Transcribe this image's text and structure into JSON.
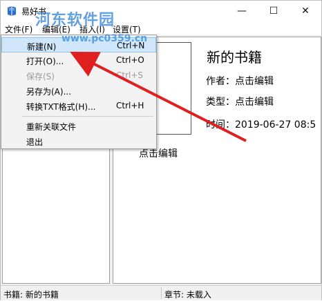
{
  "window": {
    "title": "易好书",
    "minimize_glyph": "—",
    "maximize_glyph": "☐",
    "close_glyph": "✕"
  },
  "watermark": {
    "text": "河东软件园",
    "url": "www.pc0359.cn"
  },
  "menubar": {
    "items": [
      {
        "label": "文件(F)"
      },
      {
        "label": "编辑(E)"
      },
      {
        "label": "插入(I)"
      },
      {
        "label": "设置(T)"
      }
    ]
  },
  "file_menu": {
    "items": [
      {
        "label": "新建(N)",
        "shortcut": "Ctrl+N",
        "highlighted": true,
        "enabled": true
      },
      {
        "label": "打开(O)...",
        "shortcut": "Ctrl+O",
        "enabled": true
      },
      {
        "label": "保存(S)",
        "shortcut": "Ctrl+S",
        "enabled": false
      },
      {
        "label": "另存为(A)...",
        "shortcut": "",
        "enabled": true
      },
      {
        "label": "转换TXT格式(H)...",
        "shortcut": "Ctrl+H",
        "enabled": true
      },
      {
        "label": "重新关联文件",
        "shortcut": "",
        "enabled": true
      },
      {
        "label": "退出",
        "shortcut": "",
        "enabled": true
      }
    ]
  },
  "book": {
    "title": "新的书籍",
    "author_line": "作者：点击编辑",
    "type_line": "类型：点击编辑",
    "time_line": "时间：2019-06-27 08:5",
    "description": "点击编辑"
  },
  "statusbar": {
    "book": "书籍: 新的书籍",
    "chapter": "章节: 未载入"
  },
  "colors": {
    "highlight": "#cfe6fb",
    "annotation_arrow": "#e02020",
    "watermark": "#2f82d8"
  },
  "icons": {
    "app": "book-icon"
  }
}
